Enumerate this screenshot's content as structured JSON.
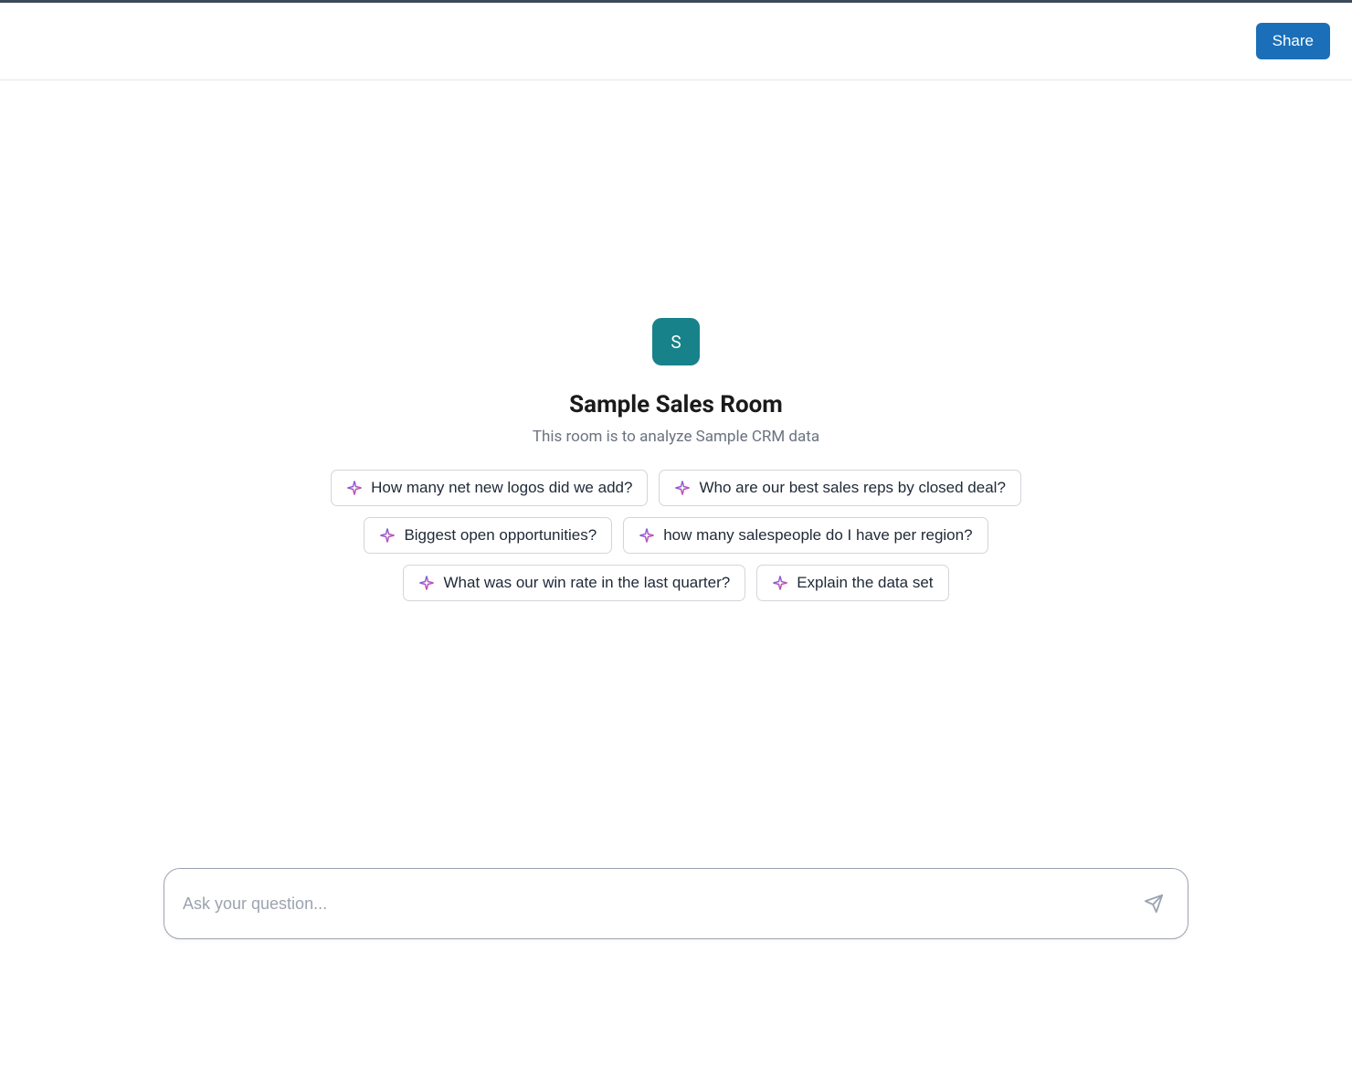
{
  "header": {
    "share_label": "Share"
  },
  "room": {
    "avatar_text": "S",
    "title": "Sample Sales Room",
    "description": "This room is to analyze Sample CRM data"
  },
  "suggestions": [
    "How many net new logos did we add?",
    "Who are our best sales reps by closed deal?",
    "Biggest open opportunities?",
    "how many salespeople do I have per region?",
    "What was our win rate in the last quarter?",
    "Explain the data set"
  ],
  "input": {
    "placeholder": "Ask your question...",
    "value": ""
  },
  "colors": {
    "primary": "#1a6fb8",
    "avatar_bg": "#17828a"
  }
}
